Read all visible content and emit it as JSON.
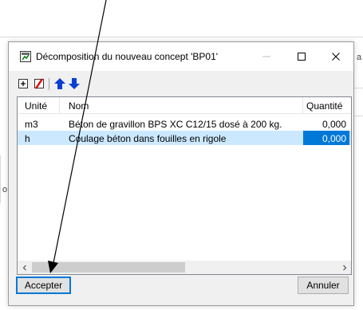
{
  "background": {
    "right_edge_char": "a",
    "left_edge_char": "o"
  },
  "dialog": {
    "title": "Décomposition du nouveau concept 'BP01'",
    "window_buttons": {
      "minimize_icon": "minimize-icon",
      "maximize_icon": "maximize-icon",
      "close_icon": "close-icon"
    },
    "toolbar": {
      "buttons": [
        {
          "name": "add-row-button",
          "icon": "plus-box-icon"
        },
        {
          "name": "delete-row-button",
          "icon": "red-slash-icon"
        },
        {
          "name": "move-up-button",
          "icon": "blue-up-arrow-icon"
        },
        {
          "name": "move-down-button",
          "icon": "blue-down-arrow-icon"
        }
      ]
    },
    "table": {
      "columns": [
        "Unité",
        "Nom",
        "Quantité"
      ],
      "rows": [
        {
          "unit": "m3",
          "name": "Béton de gravillon BPS XC C12/15 dosé à 200 kg.",
          "quantity": "0,000",
          "selected": false
        },
        {
          "unit": "h",
          "name": "Coulage béton dans fouilles en rigole",
          "quantity": "0,000",
          "selected": true
        }
      ],
      "scrollbar": {
        "left_arrow": "‹",
        "right_arrow": "›"
      }
    },
    "accept_label": "Accepter",
    "cancel_label": "Annuler"
  },
  "colors": {
    "selection_row": "#cce8ff",
    "active_cell": "#0078d7",
    "annotation_arrow": "#000000"
  }
}
